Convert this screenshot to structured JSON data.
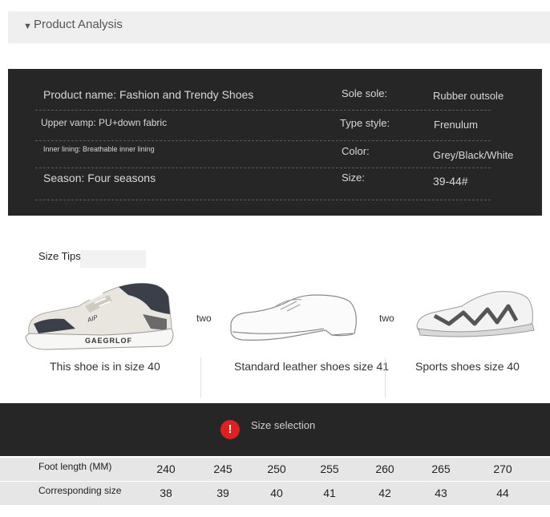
{
  "section": {
    "title": "Product Analysis"
  },
  "specs": [
    {
      "left": "Product name: Fashion and Trendy Shoes",
      "label": "Sole sole:",
      "value": "Rubber outsole"
    },
    {
      "left": "Upper vamp: PU+down fabric",
      "label": "Type style:",
      "value": "Frenulum"
    },
    {
      "left": "Inner lining: Breathable inner lining",
      "label": "Color:",
      "value": "Grey/Black/White"
    },
    {
      "left": "Season: Four seasons",
      "label": "Size:",
      "value": "39-44#"
    }
  ],
  "size_tips": {
    "title": "Size Tips",
    "connector": "two",
    "shoe_brand_text": "GAEGRLOF",
    "shoe_tag_text": "AIP",
    "captions": [
      "This shoe is in size 40",
      "Standard leather shoes size 41",
      "Sports shoes size 40"
    ]
  },
  "size_selection": {
    "icon": "alert-icon",
    "icon_glyph": "!",
    "title": "Size selection",
    "rows": [
      {
        "label": "Foot length (MM)",
        "values": [
          "240",
          "245",
          "250",
          "255",
          "260",
          "265",
          "270"
        ]
      },
      {
        "label": "Corresponding size",
        "values": [
          "38",
          "39",
          "40",
          "41",
          "42",
          "43",
          "44"
        ]
      }
    ]
  },
  "colors": {
    "panel": "#262626",
    "alert": "#e02020",
    "table_row": "#e6e6e6"
  }
}
